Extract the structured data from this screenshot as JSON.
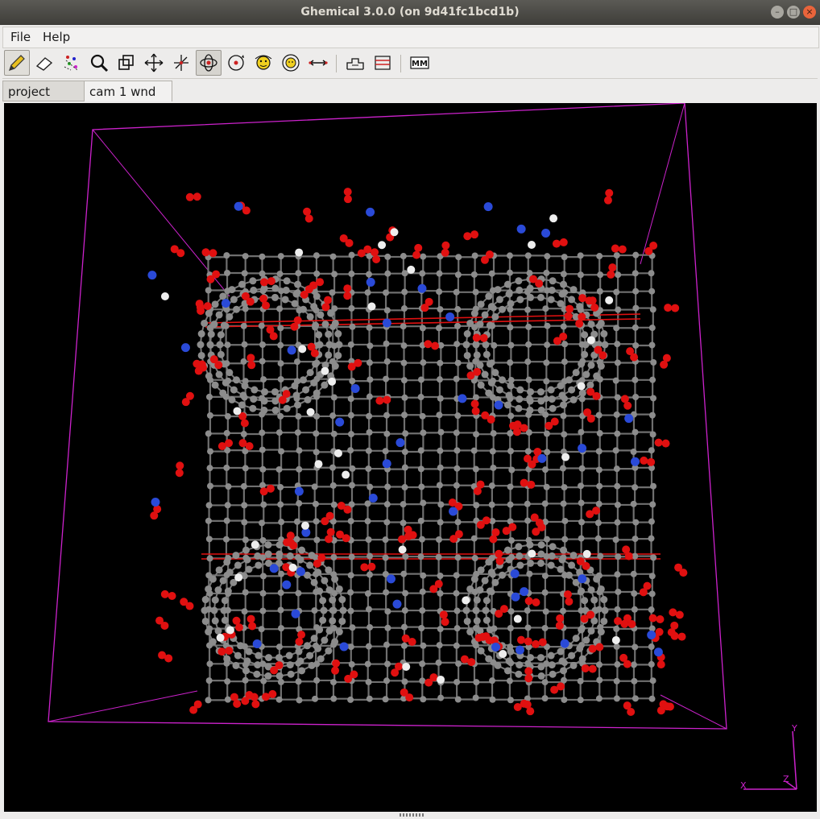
{
  "window": {
    "title": "Ghemical 3.0.0 (on 9d41fc1bcd1b)"
  },
  "menu": {
    "file": "File",
    "help": "Help"
  },
  "toolbar": {
    "tools": [
      {
        "name": "draw-tool",
        "icon": "pencil-icon"
      },
      {
        "name": "erase-tool",
        "icon": "eraser-icon"
      },
      {
        "name": "select-tool",
        "icon": "select-atoms-icon"
      },
      {
        "name": "zoom-tool",
        "icon": "magnifier-icon"
      },
      {
        "name": "clipping-tool",
        "icon": "clipping-icon"
      },
      {
        "name": "translate-xy-tool",
        "icon": "translate-xy-icon"
      },
      {
        "name": "translate-z-tool",
        "icon": "translate-z-icon"
      },
      {
        "name": "orbit-xy-tool",
        "icon": "orbit-xy-icon"
      },
      {
        "name": "orbit-z-tool",
        "icon": "orbit-z-icon"
      },
      {
        "name": "rotate-xy-tool",
        "icon": "rotate-xy-icon"
      },
      {
        "name": "rotate-z-tool",
        "icon": "rotate-z-icon"
      },
      {
        "name": "measure-tool",
        "icon": "measure-icon"
      },
      {
        "name": "element-tool",
        "icon": "element-icon"
      },
      {
        "name": "bondtype-tool",
        "icon": "bondtype-icon"
      },
      {
        "name": "mm-tool",
        "icon": "mm-icon"
      }
    ],
    "active_tool": "orbit-xy-tool",
    "mm_label": "MM"
  },
  "tabs": {
    "project_view": "project view",
    "camera": "cam 1 wnd 1"
  },
  "axes": {
    "x": "X",
    "y": "Y",
    "z": "Z"
  },
  "colors": {
    "carbon": "#8c8c8c",
    "oxygen": "#e01010",
    "nitrogen": "#2a4ad8",
    "hydrogen": "#eeeeee",
    "box": "#cc22cc",
    "background": "#000000"
  }
}
